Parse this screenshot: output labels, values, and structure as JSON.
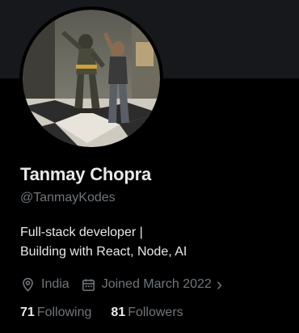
{
  "profile": {
    "name": "Tanmay Chopra",
    "handle": "@TanmayKodes",
    "bio_line1": "Full-stack developer |",
    "bio_line2": "Building with React, Node, AI",
    "location": "India",
    "joined": "Joined March 2022",
    "following_count": "71",
    "following_label": "Following",
    "followers_count": "81",
    "followers_label": "Followers"
  },
  "icons": {
    "location": "location-pin-icon",
    "calendar": "calendar-icon",
    "chevron": "chevron-right-icon"
  },
  "colors": {
    "background": "#000000",
    "banner": "#16181b",
    "primary_text": "#e7e9ea",
    "secondary_text": "#71767b"
  }
}
